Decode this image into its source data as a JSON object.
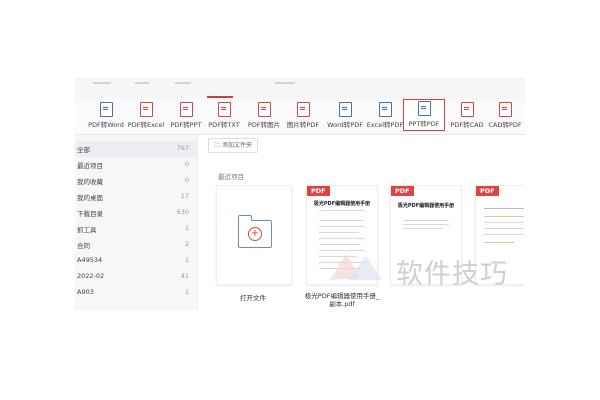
{
  "toolbar": {
    "tools": [
      {
        "label": "PDF转Word",
        "icon": "pdf-to-word-icon"
      },
      {
        "label": "PDF转Excel",
        "icon": "pdf-to-excel-icon"
      },
      {
        "label": "PDF转PPT",
        "icon": "pdf-to-ppt-icon"
      },
      {
        "label": "PDF转TXT",
        "icon": "pdf-to-txt-icon"
      },
      {
        "label": "PDF转图片",
        "icon": "pdf-to-image-icon"
      },
      {
        "label": "图片转PDF",
        "icon": "image-to-pdf-icon"
      },
      {
        "label": "Word转PDF",
        "icon": "word-to-pdf-icon"
      },
      {
        "label": "Excel转PDF",
        "icon": "excel-to-pdf-icon"
      },
      {
        "label": "PPT转PDF",
        "icon": "ppt-to-pdf-icon"
      },
      {
        "label": "PDF转CAD",
        "icon": "pdf-to-cad-icon"
      },
      {
        "label": "CAD转PDF",
        "icon": "cad-to-pdf-icon"
      }
    ],
    "active": "PPT转PDF",
    "accent": "#e03a3a"
  },
  "sidebar": {
    "items": [
      {
        "name": "全部",
        "count": "767"
      },
      {
        "name": "最近项目",
        "count": "0"
      },
      {
        "name": "我的收藏",
        "count": "0"
      },
      {
        "name": "我的桌面",
        "count": "17"
      },
      {
        "name": "下载目录",
        "count": "630"
      },
      {
        "name": "抓工具",
        "count": "1"
      },
      {
        "name": "合同",
        "count": "2"
      },
      {
        "name": "A49534",
        "count": "1"
      },
      {
        "name": "2022-02",
        "count": "41"
      },
      {
        "name": "A903",
        "count": "1"
      }
    ]
  },
  "main": {
    "add_folder": "添加文件夹",
    "recent_label": "最近项目",
    "open_file": "打开文件",
    "docs": [
      {
        "badge": "PDF",
        "heading": "极光PDF编辑器使用手册",
        "title": "极光PDF编辑器使用手册_副本.pdf"
      },
      {
        "badge": "PDF",
        "heading": "极光PDF编辑器使用手册",
        "title": ""
      },
      {
        "badge": "PDF",
        "heading": "",
        "title": ""
      }
    ]
  },
  "watermark": "软件技巧"
}
